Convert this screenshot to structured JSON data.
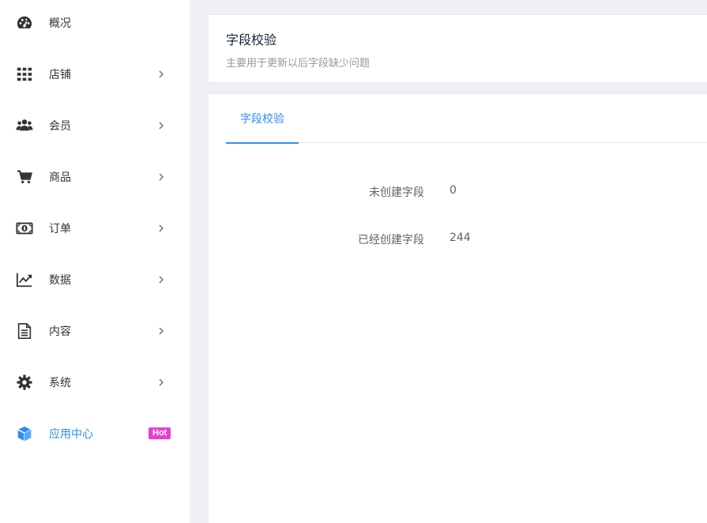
{
  "sidebar": {
    "items": [
      {
        "label": "概况",
        "icon": "dashboard-icon",
        "chevron": false
      },
      {
        "label": "店铺",
        "icon": "grid-icon",
        "chevron": true
      },
      {
        "label": "会员",
        "icon": "users-icon",
        "chevron": true
      },
      {
        "label": "商品",
        "icon": "cart-icon",
        "chevron": true
      },
      {
        "label": "订单",
        "icon": "money-icon",
        "chevron": true
      },
      {
        "label": "数据",
        "icon": "chart-line-icon",
        "chevron": true
      },
      {
        "label": "内容",
        "icon": "document-icon",
        "chevron": true
      },
      {
        "label": "系统",
        "icon": "gear-icon",
        "chevron": true
      },
      {
        "label": "应用中心",
        "icon": "cube-icon",
        "chevron": false,
        "badge": "Hot",
        "active": true
      }
    ]
  },
  "header": {
    "title": "字段校验",
    "subtitle": "主要用于更新以后字段缺少问题"
  },
  "tabs": [
    {
      "label": "字段校验",
      "active": true
    }
  ],
  "fields": [
    {
      "label": "未创建字段",
      "value": "0"
    },
    {
      "label": "已经创建字段",
      "value": "244"
    }
  ],
  "colors": {
    "accent": "#2d8cf0",
    "badge": "#e83ecf",
    "icon": "#333333"
  }
}
